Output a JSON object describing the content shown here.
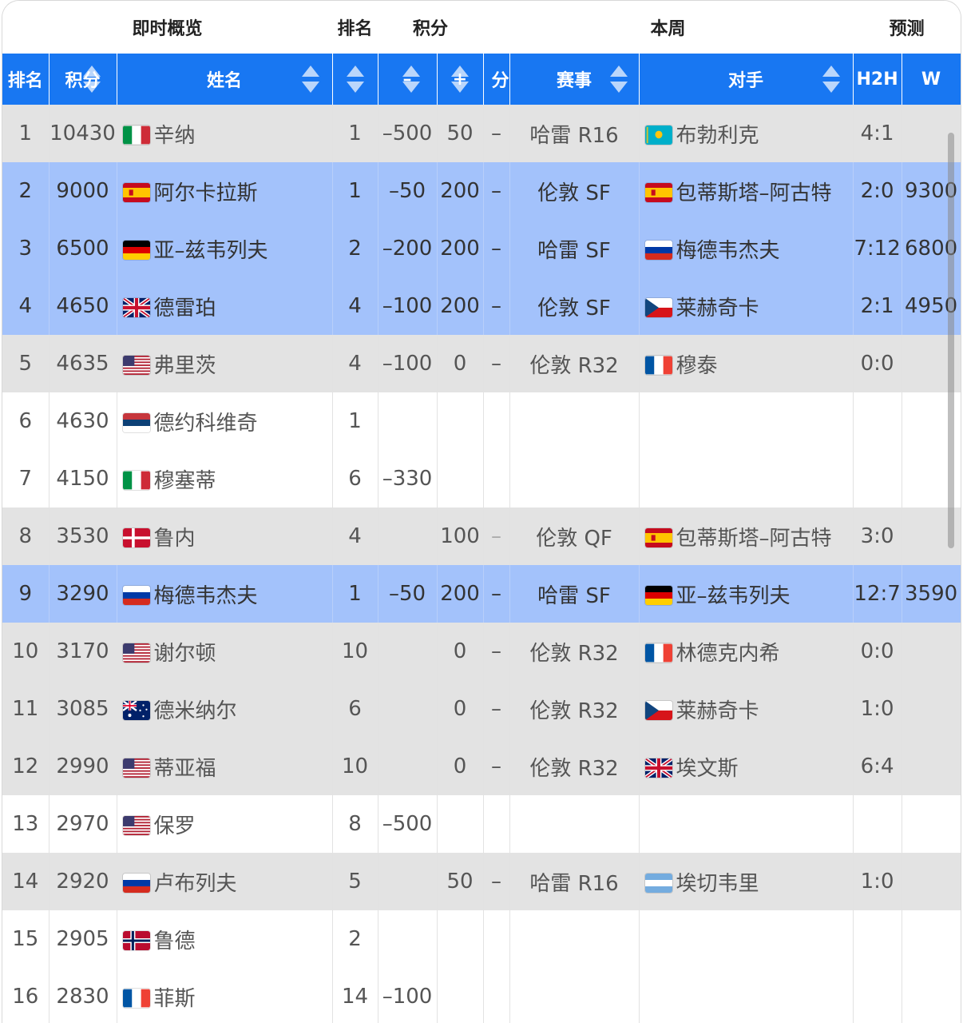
{
  "group_headers": {
    "overview": "即时概览",
    "rank": "排名",
    "points": "积分",
    "week": "本周",
    "forecast": "预测"
  },
  "columns": {
    "rank": "排名",
    "points": "积分",
    "name": "姓名",
    "rank_change": "",
    "minus": "–",
    "plus": "+",
    "fen": "分",
    "event": "赛事",
    "opponent": "对手",
    "h2h": "H2H",
    "w": "W"
  },
  "flags": {
    "it": {
      "type": "v",
      "colors": [
        "#009246",
        "#ffffff",
        "#ce2b37"
      ]
    },
    "es": {
      "type": "es",
      "colors": [
        "#c60b1e",
        "#ffc400"
      ]
    },
    "de": {
      "type": "h",
      "colors": [
        "#000000",
        "#dd0000",
        "#ffce00"
      ]
    },
    "ru": {
      "type": "h",
      "colors": [
        "#ffffff",
        "#0039a6",
        "#d52b1e"
      ]
    },
    "fr": {
      "type": "v",
      "colors": [
        "#0055a4",
        "#ffffff",
        "#ef4135"
      ]
    },
    "rs": {
      "type": "h",
      "colors": [
        "#c6363c",
        "#0c4076",
        "#ffffff"
      ]
    },
    "us": {
      "type": "us",
      "colors": [
        "#b22234",
        "#ffffff",
        "#3c3b6e"
      ]
    },
    "gb": {
      "type": "gb",
      "colors": [
        "#012169",
        "#ffffff",
        "#c8102e"
      ]
    },
    "cz": {
      "type": "cz",
      "colors": [
        "#ffffff",
        "#d7141a",
        "#11457e"
      ]
    },
    "kz": {
      "type": "kz",
      "colors": [
        "#00afca",
        "#fec50c"
      ]
    },
    "dk": {
      "type": "nordic",
      "colors": [
        "#c8102e",
        "#ffffff"
      ]
    },
    "no": {
      "type": "nordic2",
      "colors": [
        "#ba0c2f",
        "#ffffff",
        "#00205b"
      ]
    },
    "au": {
      "type": "au",
      "colors": [
        "#012169",
        "#ffffff",
        "#e4002b"
      ]
    },
    "ar": {
      "type": "h",
      "colors": [
        "#74acdf",
        "#ffffff",
        "#74acdf"
      ]
    }
  },
  "rows": [
    {
      "style": "g",
      "rank": "1",
      "points": "10430",
      "flag": "it",
      "name": "辛纳",
      "rank_change": "1",
      "minus": "–500",
      "plus": "50",
      "fen": "–",
      "event": "哈雷 R16",
      "opp_flag": "kz",
      "opponent": "布勃利克",
      "h2h": "4:1",
      "w": ""
    },
    {
      "style": "b",
      "rank": "2",
      "points": "9000",
      "flag": "es",
      "name": "阿尔卡拉斯",
      "rank_change": "1",
      "minus": "–50",
      "plus": "200",
      "fen": "–",
      "event": "伦敦 SF",
      "opp_flag": "es",
      "opponent": "包蒂斯塔–阿古特",
      "h2h": "2:0",
      "w": "9300"
    },
    {
      "style": "b",
      "rank": "3",
      "points": "6500",
      "flag": "de",
      "name": "亚–兹韦列夫",
      "rank_change": "2",
      "minus": "–200",
      "plus": "200",
      "fen": "–",
      "event": "哈雷 SF",
      "opp_flag": "ru",
      "opponent": "梅德韦杰夫",
      "h2h": "7:12",
      "w": "6800"
    },
    {
      "style": "b",
      "rank": "4",
      "points": "4650",
      "flag": "gb",
      "name": "德雷珀",
      "rank_change": "4",
      "minus": "–100",
      "plus": "200",
      "fen": "–",
      "event": "伦敦 SF",
      "opp_flag": "cz",
      "opponent": "莱赫奇卡",
      "h2h": "2:1",
      "w": "4950"
    },
    {
      "style": "g",
      "rank": "5",
      "points": "4635",
      "flag": "us",
      "name": "弗里茨",
      "rank_change": "4",
      "minus": "–100",
      "plus": "0",
      "fen": "–",
      "event": "伦敦 R32",
      "opp_flag": "fr",
      "opponent": "穆泰",
      "h2h": "0:0",
      "w": ""
    },
    {
      "style": "w",
      "rank": "6",
      "points": "4630",
      "flag": "rs",
      "name": "德约科维奇",
      "rank_change": "1",
      "minus": "",
      "plus": "",
      "fen": "",
      "event": "",
      "opp_flag": "",
      "opponent": "",
      "h2h": "",
      "w": ""
    },
    {
      "style": "w",
      "rank": "7",
      "points": "4150",
      "flag": "it",
      "name": "穆塞蒂",
      "rank_change": "6",
      "minus": "–330",
      "plus": "",
      "fen": "",
      "event": "",
      "opp_flag": "",
      "opponent": "",
      "h2h": "",
      "w": ""
    },
    {
      "style": "g",
      "rank": "8",
      "points": "3530",
      "flag": "dk",
      "name": "鲁内",
      "rank_change": "4",
      "minus": "",
      "plus": "100",
      "fen": "–",
      "event": "伦敦 QF",
      "opp_flag": "es",
      "opponent": "包蒂斯塔–阿古特",
      "h2h": "3:0",
      "w": ""
    },
    {
      "style": "b",
      "rank": "9",
      "points": "3290",
      "flag": "ru",
      "name": "梅德韦杰夫",
      "rank_change": "1",
      "minus": "–50",
      "plus": "200",
      "fen": "–",
      "event": "哈雷 SF",
      "opp_flag": "de",
      "opponent": "亚–兹韦列夫",
      "h2h": "12:7",
      "w": "3590"
    },
    {
      "style": "g",
      "rank": "10",
      "points": "3170",
      "flag": "us",
      "name": "谢尔顿",
      "rank_change": "10",
      "minus": "",
      "plus": "0",
      "fen": "–",
      "event": "伦敦 R32",
      "opp_flag": "fr",
      "opponent": "林德克内希",
      "h2h": "0:0",
      "w": ""
    },
    {
      "style": "g",
      "rank": "11",
      "points": "3085",
      "flag": "au",
      "name": "德米纳尔",
      "rank_change": "6",
      "minus": "",
      "plus": "0",
      "fen": "–",
      "event": "伦敦 R32",
      "opp_flag": "cz",
      "opponent": "莱赫奇卡",
      "h2h": "1:0",
      "w": ""
    },
    {
      "style": "g",
      "rank": "12",
      "points": "2990",
      "flag": "us",
      "name": "蒂亚福",
      "rank_change": "10",
      "minus": "",
      "plus": "0",
      "fen": "–",
      "event": "伦敦 R32",
      "opp_flag": "gb",
      "opponent": "埃文斯",
      "h2h": "6:4",
      "w": ""
    },
    {
      "style": "w",
      "rank": "13",
      "points": "2970",
      "flag": "us",
      "name": "保罗",
      "rank_change": "8",
      "minus": "–500",
      "plus": "",
      "fen": "",
      "event": "",
      "opp_flag": "",
      "opponent": "",
      "h2h": "",
      "w": ""
    },
    {
      "style": "g",
      "rank": "14",
      "points": "2920",
      "flag": "ru",
      "name": "卢布列夫",
      "rank_change": "5",
      "minus": "",
      "plus": "50",
      "fen": "–",
      "event": "哈雷 R16",
      "opp_flag": "ar",
      "opponent": "埃切韦里",
      "h2h": "1:0",
      "w": ""
    },
    {
      "style": "w",
      "rank": "15",
      "points": "2905",
      "flag": "no",
      "name": "鲁德",
      "rank_change": "2",
      "minus": "",
      "plus": "",
      "fen": "",
      "event": "",
      "opp_flag": "",
      "opponent": "",
      "h2h": "",
      "w": ""
    },
    {
      "style": "w",
      "rank": "16",
      "points": "2830",
      "flag": "fr",
      "name": "菲斯",
      "rank_change": "14",
      "minus": "–100",
      "plus": "",
      "fen": "",
      "event": "",
      "opp_flag": "",
      "opponent": "",
      "h2h": "",
      "w": ""
    }
  ]
}
